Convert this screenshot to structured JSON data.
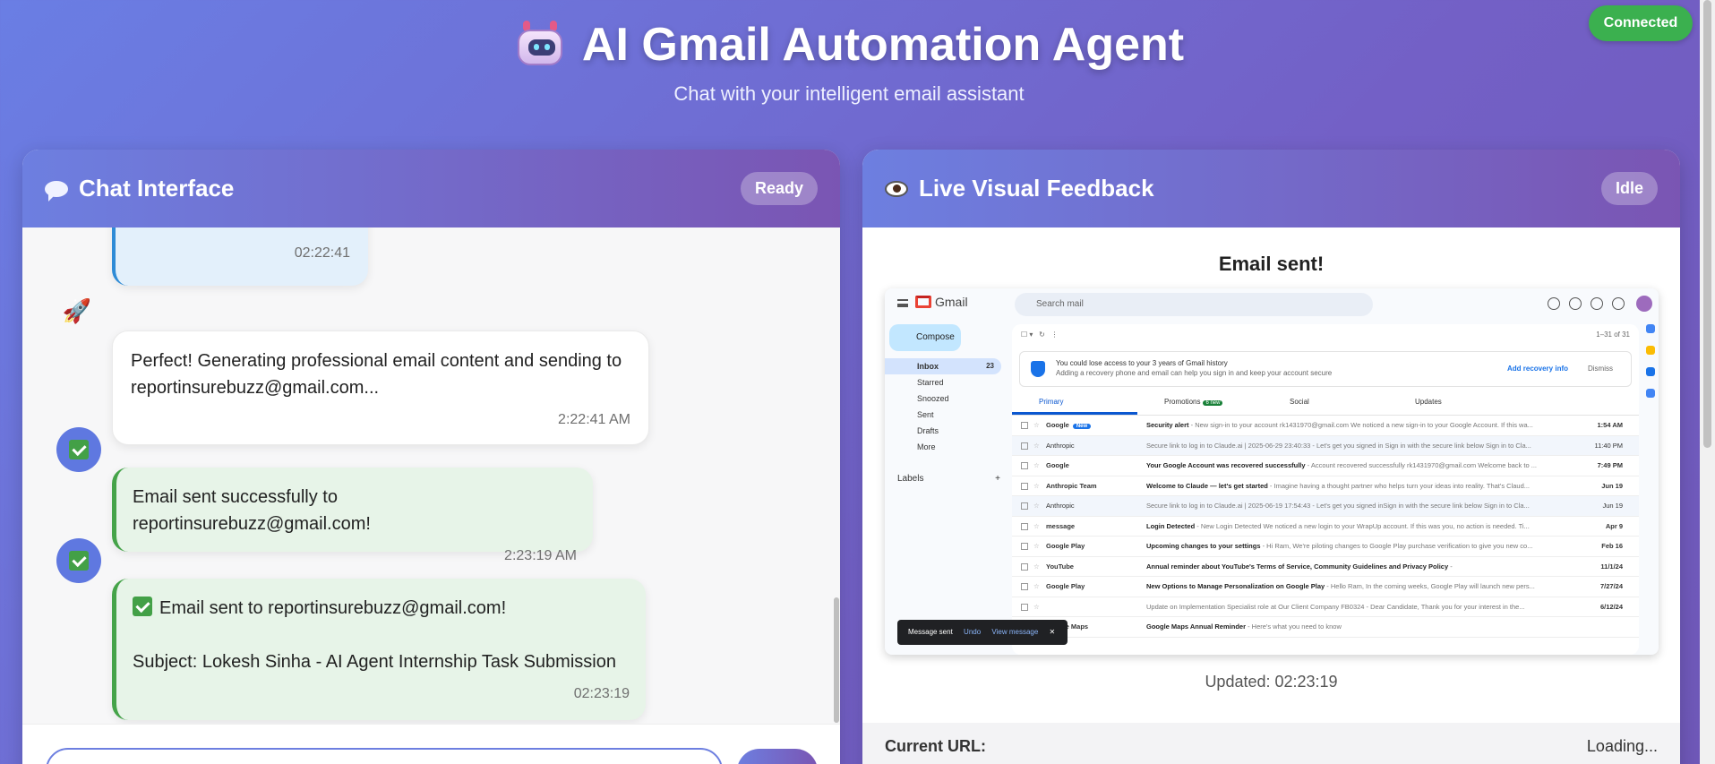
{
  "header": {
    "title": "AI Gmail Automation Agent",
    "subtitle": "Chat with your intelligent email assistant",
    "connection_status": "Connected"
  },
  "chat_panel": {
    "title": "Chat Interface",
    "status": "Ready",
    "messages": [
      {
        "type": "user",
        "text": "",
        "time": "02:22:41"
      },
      {
        "type": "bot",
        "avatar": "rocket-icon",
        "text": "Perfect! Generating professional email content and sending to reportinsurebuzz@gmail.com...",
        "time": "2:22:41 AM"
      },
      {
        "type": "success",
        "avatar": "check-icon",
        "text": "Email sent successfully to reportinsurebuzz@gmail.com!",
        "time": "2:23:19 AM"
      },
      {
        "type": "success",
        "avatar": "check-icon",
        "line1": "Email sent to reportinsurebuzz@gmail.com!",
        "line2": "Subject: Lokesh Sinha - AI Agent Internship Task Submission",
        "time": "02:23:19"
      }
    ]
  },
  "feedback_panel": {
    "title": "Live Visual Feedback",
    "status": "Idle",
    "screenshot_title": "Email sent!",
    "updated": "Updated: 02:23:19",
    "url_label": "Current URL:",
    "url_value": "Loading...",
    "gmail": {
      "brand": "Gmail",
      "search_placeholder": "Search mail",
      "compose": "Compose",
      "pagination": "1–31 of 31",
      "nav": [
        {
          "label": "Inbox",
          "count": "23"
        },
        {
          "label": "Starred",
          "count": ""
        },
        {
          "label": "Snoozed",
          "count": ""
        },
        {
          "label": "Sent",
          "count": ""
        },
        {
          "label": "Drafts",
          "count": ""
        },
        {
          "label": "More",
          "count": ""
        }
      ],
      "labels_heading": "Labels",
      "banner_title": "You could lose access to your 3 years of Gmail history",
      "banner_sub": "Adding a recovery phone and email can help you sign in and keep your account secure",
      "banner_action": "Add recovery info",
      "banner_dismiss": "Dismiss",
      "tabs": [
        {
          "label": "Primary",
          "extra": ""
        },
        {
          "label": "Promotions",
          "extra": "6 new"
        },
        {
          "label": "Social",
          "extra": ""
        },
        {
          "label": "Updates",
          "extra": ""
        }
      ],
      "rows": [
        {
          "from": "Google",
          "subject": "Security alert",
          "snippet": " - New sign-in to your account rk1431970@gmail.com We noticed a new sign-in to your Google Account. If this wa...",
          "date": "1:54 AM",
          "tag": "New"
        },
        {
          "from": "Anthropic",
          "subject": "",
          "snippet": "Secure link to log in to Claude.ai | 2025-06-29 23:40:33 - Let's get you signed in Sign in with the secure link below Sign in to Cla...",
          "date": "11:40 PM",
          "tag": ""
        },
        {
          "from": "Google",
          "subject": "Your Google Account was recovered successfully",
          "snippet": " - Account recovered successfully rk1431970@gmail.com Welcome back to ...",
          "date": "7:49 PM",
          "tag": ""
        },
        {
          "from": "Anthropic Team",
          "subject": "Welcome to Claude — let's get started",
          "snippet": " - Imagine having a thought partner who helps turn your ideas into reality. That's Claud...",
          "date": "Jun 19",
          "tag": ""
        },
        {
          "from": "Anthropic",
          "subject": "",
          "snippet": "Secure link to log in to Claude.ai | 2025-06-19 17:54:43 - Let's get you signed inSign in with the secure link below Sign in to Cla...",
          "date": "Jun 19",
          "tag": ""
        },
        {
          "from": "message",
          "subject": "Login Detected",
          "snippet": " - New Login Detected We noticed a new login to your WrapUp account. If this was you, no action is needed. Ti...",
          "date": "Apr 9",
          "tag": ""
        },
        {
          "from": "Google Play",
          "subject": "Upcoming changes to your settings",
          "snippet": " - Hi Ram, We're piloting changes to Google Play purchase verification to give you new co...",
          "date": "Feb 16",
          "tag": ""
        },
        {
          "from": "YouTube",
          "subject": "Annual reminder about YouTube's Terms of Service, Community Guidelines and Privacy Policy",
          "snippet": " -",
          "date": "11/1/24",
          "tag": ""
        },
        {
          "from": "Google Play",
          "subject": "New Options to Manage Personalization on Google Play",
          "snippet": " - Hello Ram, In the coming weeks, Google Play will launch new pers...",
          "date": "7/27/24",
          "tag": ""
        },
        {
          "from": "",
          "subject": "",
          "snippet": "Update on Implementation Specialist role at Our Client Company FB0324 - Dear Candidate, Thank you for your interest in the...",
          "date": "6/12/24",
          "tag": ""
        },
        {
          "from": "Google Maps",
          "subject": "Google Maps Annual Reminder",
          "snippet": " - Here's what you need to know",
          "date": "",
          "tag": ""
        }
      ],
      "toast": {
        "text": "Message sent",
        "undo": "Undo",
        "view": "View message",
        "close": "✕"
      }
    }
  }
}
